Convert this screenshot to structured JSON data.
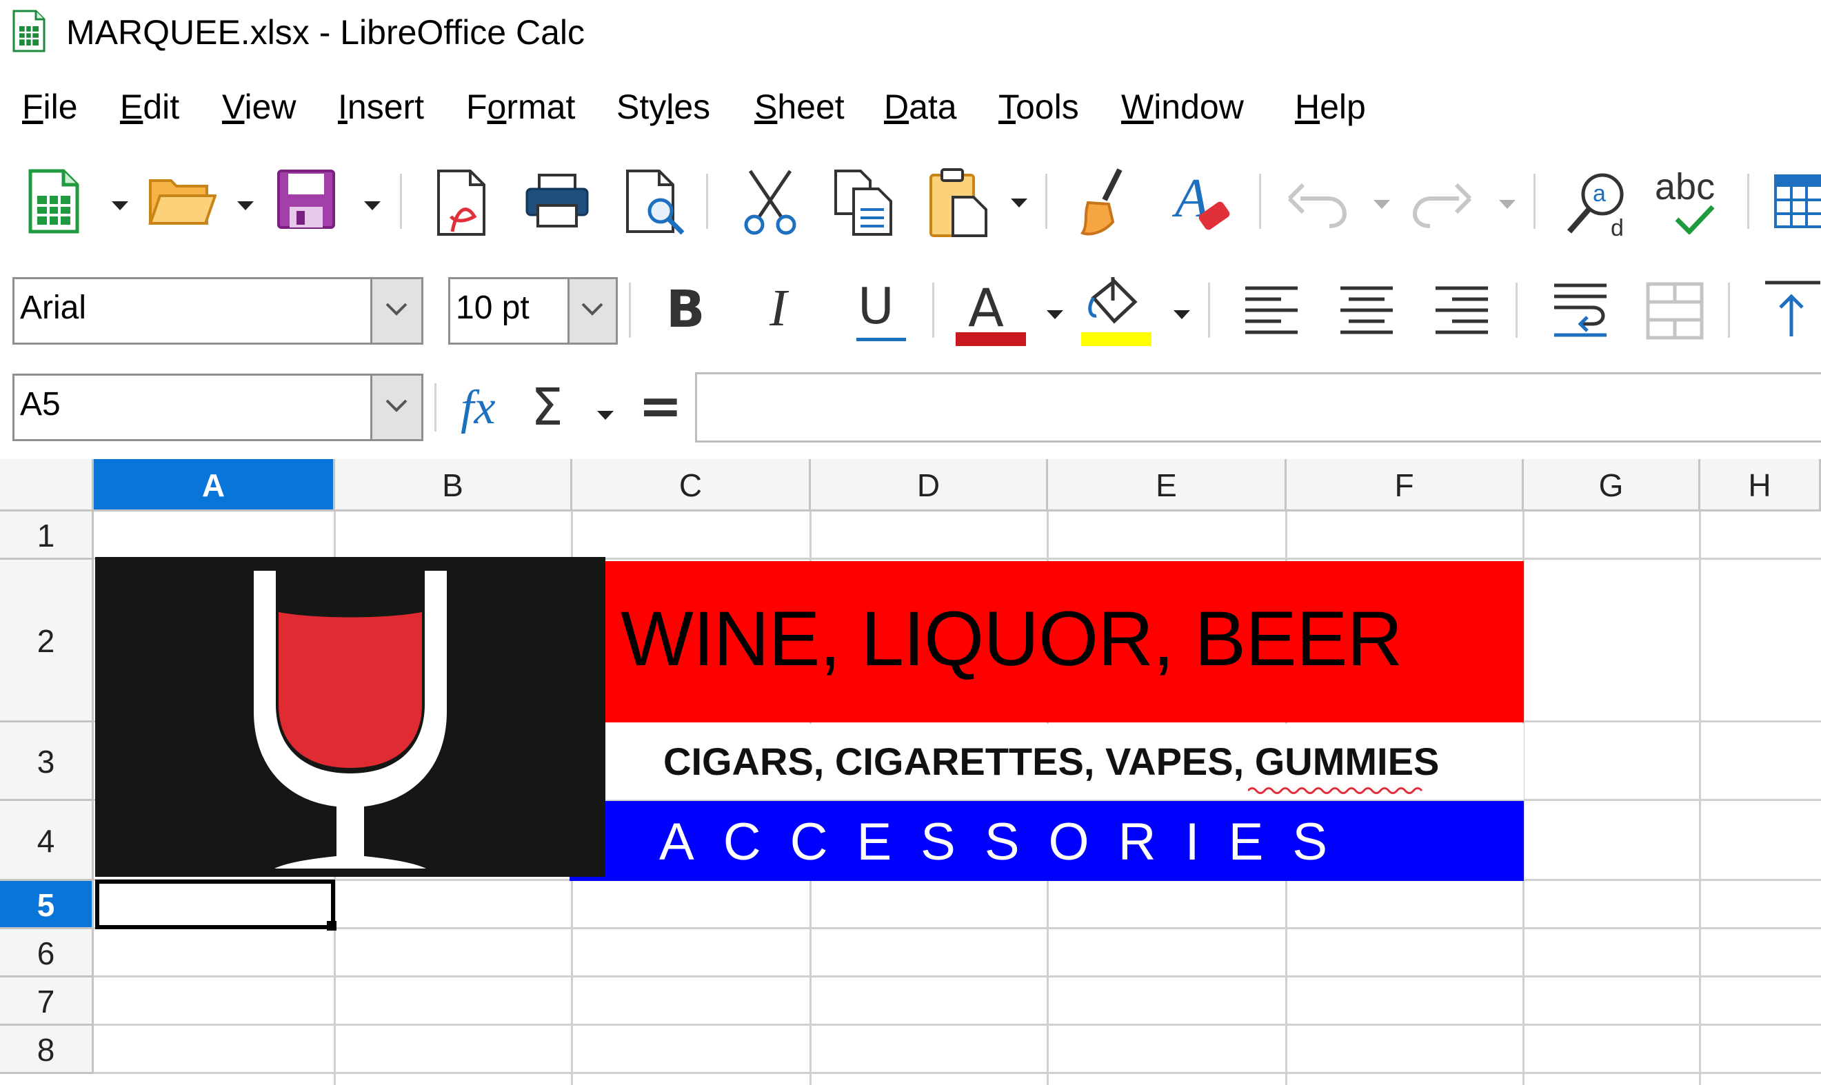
{
  "window": {
    "title": "MARQUEE.xlsx - LibreOffice Calc",
    "app_icon": "calc-spreadsheet-icon"
  },
  "menu": {
    "items": [
      {
        "label": "File",
        "underline_index": 0
      },
      {
        "label": "Edit",
        "underline_index": 0
      },
      {
        "label": "View",
        "underline_index": 0
      },
      {
        "label": "Insert",
        "underline_index": 0
      },
      {
        "label": "Format",
        "underline_index": 1
      },
      {
        "label": "Styles",
        "underline_index": 3
      },
      {
        "label": "Sheet",
        "underline_index": 0
      },
      {
        "label": "Data",
        "underline_index": 0
      },
      {
        "label": "Tools",
        "underline_index": 0
      },
      {
        "label": "Window",
        "underline_index": 0
      },
      {
        "label": "Help",
        "underline_index": 0
      }
    ]
  },
  "toolbar_standard": {
    "buttons": [
      "new-spreadsheet-icon",
      "open-folder-icon",
      "save-icon",
      "export-pdf-icon",
      "print-icon",
      "print-preview-icon",
      "cut-icon",
      "copy-icon",
      "paste-icon",
      "clone-formatting-icon",
      "clear-formatting-icon",
      "undo-icon",
      "redo-icon",
      "find-replace-icon",
      "spelling-icon",
      "row-column-icon"
    ],
    "spellcheck_label": "abc"
  },
  "toolbar_formatting": {
    "font_name": "Arial",
    "font_size": "10 pt",
    "bold_label": "B",
    "italic_label": "I",
    "underline_label": "U",
    "font_color_label": "A",
    "font_color": "#c8191e",
    "highlight_color": "#ffff00"
  },
  "formula_bar": {
    "name_box": "A5",
    "function_wizard_label": "fx",
    "sum_label": "Σ",
    "equals_label": "=",
    "formula_value": ""
  },
  "sheet": {
    "columns": [
      "A",
      "B",
      "C",
      "D",
      "E",
      "F",
      "G",
      "H"
    ],
    "selected_column": "A",
    "rows": [
      "1",
      "2",
      "3",
      "4",
      "5",
      "6",
      "7",
      "8"
    ],
    "selected_row": "5",
    "active_cell": "A5",
    "banner": {
      "line1": "WINE, LIQUOR, BEER",
      "line1_bg": "#ff0000",
      "line2": "CIGARS, CIGARETTES, VAPES, GUMMIES",
      "line3": "ACCESSORIES",
      "line3_bg": "#0000ff",
      "logo_icon": "wine-glass-icon",
      "logo_bg": "#141714",
      "wine_color": "#e02b33"
    }
  }
}
